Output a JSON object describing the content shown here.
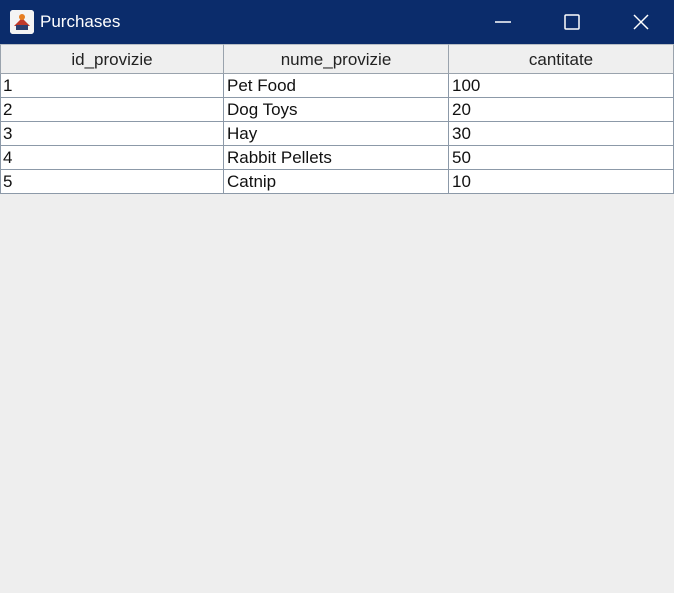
{
  "window": {
    "title": "Purchases"
  },
  "titlebar": {
    "icon": "java-app-icon",
    "controls": [
      "minimize-icon",
      "maximize-icon",
      "close-icon"
    ]
  },
  "table": {
    "columns": [
      "id_provizie",
      "nume_provizie",
      "cantitate"
    ],
    "rows": [
      [
        "1",
        "Pet Food",
        "100"
      ],
      [
        "2",
        "Dog Toys",
        "20"
      ],
      [
        "3",
        "Hay",
        "30"
      ],
      [
        "4",
        "Rabbit Pellets",
        "50"
      ],
      [
        "5",
        "Catnip",
        "10"
      ]
    ]
  },
  "colors": {
    "titlebar": "#0b2c6b",
    "background": "#eeeeee",
    "grid": "#8c99a8"
  }
}
